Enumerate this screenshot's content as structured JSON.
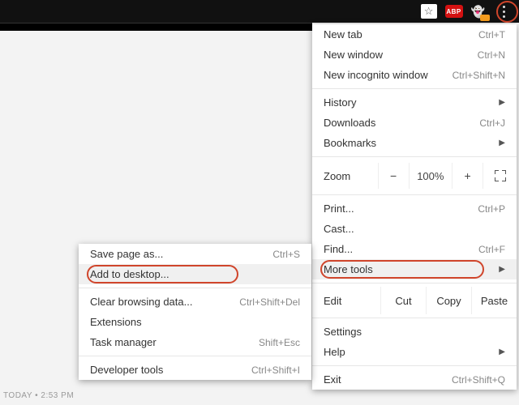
{
  "toolbar": {
    "abp_label": "ABP"
  },
  "main_menu": {
    "new_tab": {
      "label": "New tab",
      "shortcut": "Ctrl+T"
    },
    "new_window": {
      "label": "New window",
      "shortcut": "Ctrl+N"
    },
    "new_incognito": {
      "label": "New incognito window",
      "shortcut": "Ctrl+Shift+N"
    },
    "history": {
      "label": "History"
    },
    "downloads": {
      "label": "Downloads",
      "shortcut": "Ctrl+J"
    },
    "bookmarks": {
      "label": "Bookmarks"
    },
    "zoom": {
      "label": "Zoom",
      "minus": "−",
      "pct": "100%",
      "plus": "+"
    },
    "print": {
      "label": "Print...",
      "shortcut": "Ctrl+P"
    },
    "cast": {
      "label": "Cast..."
    },
    "find": {
      "label": "Find...",
      "shortcut": "Ctrl+F"
    },
    "more_tools": {
      "label": "More tools"
    },
    "edit": {
      "label": "Edit",
      "cut": "Cut",
      "copy": "Copy",
      "paste": "Paste"
    },
    "settings": {
      "label": "Settings"
    },
    "help": {
      "label": "Help"
    },
    "exit": {
      "label": "Exit",
      "shortcut": "Ctrl+Shift+Q"
    }
  },
  "submenu": {
    "save_page": {
      "label": "Save page as...",
      "shortcut": "Ctrl+S"
    },
    "add_desktop": {
      "label": "Add to desktop..."
    },
    "clear_browsing": {
      "label": "Clear browsing data...",
      "shortcut": "Ctrl+Shift+Del"
    },
    "extensions": {
      "label": "Extensions"
    },
    "task_manager": {
      "label": "Task manager",
      "shortcut": "Shift+Esc"
    },
    "dev_tools": {
      "label": "Developer tools",
      "shortcut": "Ctrl+Shift+I"
    }
  },
  "timestamp": "TODAY • 2:53 PM"
}
